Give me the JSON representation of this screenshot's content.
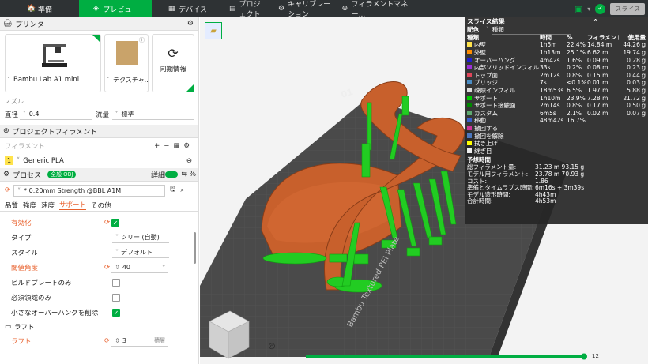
{
  "topbar": {
    "tabs": [
      {
        "icon": "🏠",
        "label": "準備"
      },
      {
        "icon": "◈",
        "label": "プレビュー"
      },
      {
        "icon": "▦",
        "label": "デバイス"
      },
      {
        "icon": "▤",
        "label": "プロジェクト"
      },
      {
        "icon": "⚙",
        "label": "キャリブレーション"
      },
      {
        "icon": "⊕",
        "label": "フィラメントマネー..."
      }
    ],
    "slice_label": "スライス"
  },
  "printer": {
    "section": "プリンター",
    "name": "Bambu Lab A1 mini",
    "plate": "テクスチャ...",
    "sync": "同期情報"
  },
  "nozzle": {
    "label": "ノズル",
    "diameter_label": "直径",
    "diameter": "0.4",
    "flow_label": "流量",
    "flow": "標準"
  },
  "filament": {
    "section": "プロジェクトフィラメント",
    "label": "フィラメント",
    "index": "1",
    "name": "Generic PLA"
  },
  "process": {
    "section": "プロセス",
    "global": "全般",
    "obj": "OBJ",
    "detail": "詳細",
    "preset": "* 0.20mm Strength @BBL A1M",
    "tabs": [
      "品質",
      "強度",
      "速度",
      "サポート",
      "その他"
    ],
    "rows": [
      {
        "label": "有効化",
        "value": ""
      },
      {
        "label": "タイプ",
        "value": "ツリー (自動)"
      },
      {
        "label": "スタイル",
        "value": "デフォルト"
      },
      {
        "label": "閾値角度",
        "value": "40"
      },
      {
        "label": "ビルドプレートのみ",
        "value": ""
      },
      {
        "label": "必須領域のみ",
        "value": ""
      },
      {
        "label": "小さなオーバーハングを削除",
        "value": ""
      }
    ],
    "raft_section": "ラフト",
    "raft_label": "ラフト",
    "raft_value": "3",
    "raft_unit": "積層",
    "threshold_unit": "°"
  },
  "stats": {
    "title": "スライス結果",
    "config_label": "配色",
    "config_value": "種類",
    "headers": [
      "種類",
      "時間",
      "%",
      "フィラメント",
      "使用量"
    ],
    "rows": [
      {
        "name": "内壁",
        "time": "1h5m",
        "pct": "22.4%",
        "fil": "14.84 m",
        "use": "44.26 g",
        "color": "#ffe34c"
      },
      {
        "name": "外壁",
        "time": "1h13m",
        "pct": "25.1%",
        "fil": "6.62 m",
        "use": "19.74 g",
        "color": "#ff8c00"
      },
      {
        "name": "オーバーハング",
        "time": "4m42s",
        "pct": "1.6%",
        "fil": "0.09 m",
        "use": "0.28 g",
        "color": "#1e1ecc"
      },
      {
        "name": "内部ソリッドインフィル",
        "time": "33s",
        "pct": "0.2%",
        "fil": "0.08 m",
        "use": "0.23 g",
        "color": "#9b30d9"
      },
      {
        "name": "トップ面",
        "time": "2m12s",
        "pct": "0.8%",
        "fil": "0.15 m",
        "use": "0.44 g",
        "color": "#e0455a"
      },
      {
        "name": "ブリッジ",
        "time": "7s",
        "pct": "<0.1%",
        "fil": "0.01 m",
        "use": "0.03 g",
        "color": "#4a8cc4"
      },
      {
        "name": "疎隙インフィル",
        "time": "18m53s",
        "pct": "6.5%",
        "fil": "1.97 m",
        "use": "5.88 g",
        "color": "#dddddd"
      },
      {
        "name": "サポート",
        "time": "1h10m",
        "pct": "23.9%",
        "fil": "7.28 m",
        "use": "21.72 g",
        "color": "#00cc00"
      },
      {
        "name": "サポート接触面",
        "time": "2m14s",
        "pct": "0.8%",
        "fil": "0.17 m",
        "use": "0.50 g",
        "color": "#008800"
      },
      {
        "name": "カスタム",
        "time": "6m5s",
        "pct": "2.1%",
        "fil": "0.02 m",
        "use": "0.07 g",
        "color": "#5eaa70"
      },
      {
        "name": "移動",
        "time": "48m42s",
        "pct": "16.7%",
        "fil": "",
        "use": "",
        "color": "#3a5fcd"
      },
      {
        "name": "撤回する",
        "time": "",
        "pct": "",
        "fil": "",
        "use": "",
        "color": "#cc3399"
      },
      {
        "name": "撤回を解除",
        "time": "",
        "pct": "",
        "fil": "",
        "use": "",
        "color": "#4b77be"
      },
      {
        "name": "拭き上げ",
        "time": "",
        "pct": "",
        "fil": "",
        "use": "",
        "color": "#ffff00"
      },
      {
        "name": "継ぎ目",
        "time": "",
        "pct": "",
        "fil": "",
        "use": "",
        "color": "#eeeeee"
      }
    ],
    "estimate_title": "予想時間",
    "estimates": [
      {
        "k": "総フィラメント量:",
        "v": "31.23 m   93.15 g"
      },
      {
        "k": "モデル用フィラメント:",
        "v": "23.78 m   70.93 g"
      },
      {
        "k": "コスト:",
        "v": "1.86"
      },
      {
        "k": "準備とタイムラプス時間:",
        "v": "6m16s + 3m39s"
      },
      {
        "k": "モデル造形時間:",
        "v": "4h43m"
      },
      {
        "k": "合計時間:",
        "v": "4h53m"
      }
    ]
  },
  "viewport": {
    "plate_label": "Bambu Textured PEI Plate",
    "plate_number": "01",
    "layer_max": "12"
  },
  "colors": {
    "accent": "#00ae42",
    "model": "#c8602c",
    "support": "#22cc22"
  }
}
